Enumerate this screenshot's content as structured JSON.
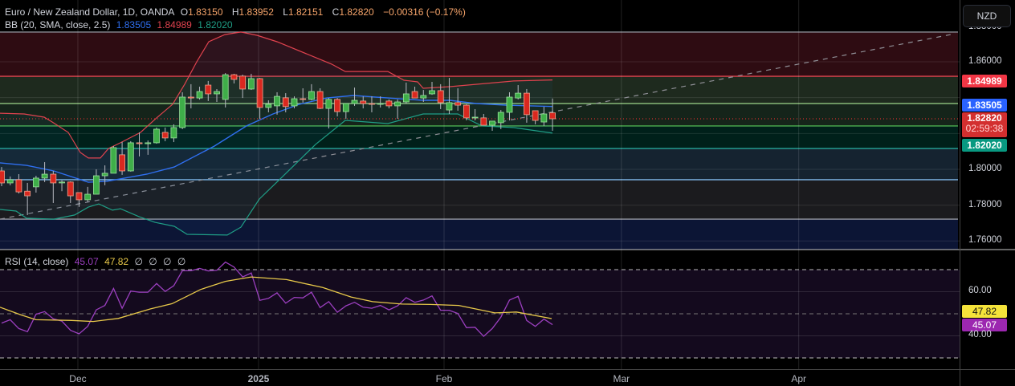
{
  "header": {
    "symbol_title": "Euro / New Zealand Dollar, 1D, OANDA",
    "open_label": "O",
    "open": "1.83150",
    "high_label": "H",
    "high": "1.83952",
    "low_label": "L",
    "low": "1.82151",
    "close_label": "C",
    "close": "1.82820",
    "change": "−0.00316 (−0.17%)"
  },
  "bb_legend": {
    "label": "BB (20, SMA, close, 2.5)",
    "basis": "1.83505",
    "upper": "1.84989",
    "lower": "1.82020"
  },
  "rsi_legend": {
    "label": "RSI (14, close)",
    "rsi": "45.07",
    "ma": "47.82",
    "extras": [
      "∅",
      "∅",
      "∅",
      "∅"
    ]
  },
  "currency_button": "NZD",
  "price_axis": {
    "ticks": [
      "1.88000",
      "1.86000",
      "1.80000",
      "1.78000",
      "1.76000"
    ],
    "badges": {
      "upper": "1.84989",
      "basis": "1.83505",
      "last": "1.82820",
      "countdown": "02:59:38",
      "lower": "1.82020"
    }
  },
  "rsi_axis": {
    "ticks": [
      "60.00",
      "40.00"
    ],
    "ma_badge": "47.82",
    "rsi_badge": "45.07"
  },
  "time_axis": [
    "Dec",
    "2025",
    "Feb",
    "Mar",
    "Apr"
  ],
  "colors": {
    "up": "#3fae49",
    "down": "#d9281f",
    "bb_upper": "#e0434f",
    "bb_basis": "#2f6ff0",
    "bb_lower": "#1f9e86",
    "rsi": "#9b3fbf",
    "rsi_ma": "#e8c94a",
    "last": "#d32f2f"
  },
  "chart_data": [
    {
      "type": "candlestick",
      "title": "Euro / New Zealand Dollar, 1D, OANDA",
      "ylim": [
        1.755,
        1.8785
      ],
      "yticks": [
        1.88,
        1.86,
        1.84,
        1.82,
        1.8,
        1.78,
        1.76
      ],
      "x_ticks": [
        {
          "label": "Dec",
          "bar": 8.86
        },
        {
          "label": "2025",
          "bar": 29.85
        },
        {
          "label": "Feb",
          "bar": 51.4
        },
        {
          "label": "Mar",
          "bar": 72.0
        },
        {
          "label": "Apr",
          "bar": 92.6
        }
      ],
      "ohlc": [
        [
          1.7991,
          1.8013,
          1.7906,
          1.7924
        ],
        [
          1.7924,
          1.796,
          1.7911,
          1.7942
        ],
        [
          1.7942,
          1.7973,
          1.7865,
          1.7874
        ],
        [
          1.7878,
          1.7924,
          1.7745,
          1.7852
        ],
        [
          1.7902,
          1.7964,
          1.787,
          1.7951
        ],
        [
          1.7951,
          1.804,
          1.7929,
          1.7973
        ],
        [
          1.7973,
          1.7991,
          1.7812,
          1.7924
        ],
        [
          1.7924,
          1.7938,
          1.7878,
          1.7929
        ],
        [
          1.7929,
          1.7933,
          1.7812,
          1.7852
        ],
        [
          1.787,
          1.787,
          1.779,
          1.783
        ],
        [
          1.783,
          1.7902,
          1.7817,
          1.7861
        ],
        [
          1.7861,
          1.8,
          1.7861,
          1.7964
        ],
        [
          1.7964,
          1.8022,
          1.7911,
          1.7978
        ],
        [
          1.7978,
          1.813,
          1.7978,
          1.8121
        ],
        [
          1.8081,
          1.8153,
          1.7969,
          1.7991
        ],
        [
          1.7991,
          1.8157,
          1.7987,
          1.8148
        ],
        [
          1.8148,
          1.8206,
          1.8072,
          1.8143
        ],
        [
          1.8143,
          1.8161,
          1.8081,
          1.8148
        ],
        [
          1.8148,
          1.8233,
          1.8143,
          1.8224
        ],
        [
          1.8206,
          1.8233,
          1.8157,
          1.8175
        ],
        [
          1.8175,
          1.8251,
          1.8152,
          1.8233
        ],
        [
          1.8233,
          1.843,
          1.8224,
          1.8403
        ],
        [
          1.8403,
          1.8475,
          1.834,
          1.8398
        ],
        [
          1.8398,
          1.8461,
          1.8389,
          1.8434
        ],
        [
          1.847,
          1.8493,
          1.8381,
          1.8421
        ],
        [
          1.8421,
          1.8448,
          1.8376,
          1.8434
        ],
        [
          1.839,
          1.8537,
          1.8345,
          1.8528
        ],
        [
          1.8528,
          1.8533,
          1.8479,
          1.8502
        ],
        [
          1.852,
          1.8528,
          1.8398,
          1.8448
        ],
        [
          1.8448,
          1.8533,
          1.8443,
          1.8506
        ],
        [
          1.8506,
          1.851,
          1.8282,
          1.8345
        ],
        [
          1.8345,
          1.8385,
          1.8318,
          1.8363
        ],
        [
          1.8354,
          1.843,
          1.8305,
          1.8407
        ],
        [
          1.8399,
          1.8425,
          1.8318,
          1.835
        ],
        [
          1.8354,
          1.8407,
          1.834,
          1.8394
        ],
        [
          1.8394,
          1.8452,
          1.8372,
          1.839
        ],
        [
          1.839,
          1.8475,
          1.8385,
          1.8434
        ],
        [
          1.8434,
          1.8452,
          1.8336,
          1.834
        ],
        [
          1.834,
          1.8398,
          1.8228,
          1.839
        ],
        [
          1.839,
          1.8398,
          1.8295,
          1.8322
        ],
        [
          1.8322,
          1.8367,
          1.8282,
          1.8367
        ],
        [
          1.8367,
          1.8456,
          1.8354,
          1.8385
        ],
        [
          1.8381,
          1.8407,
          1.834,
          1.8367
        ],
        [
          1.8367,
          1.8407,
          1.8318,
          1.8363
        ],
        [
          1.8363,
          1.8407,
          1.8345,
          1.8367
        ],
        [
          1.8381,
          1.839,
          1.834,
          1.8354
        ],
        [
          1.8354,
          1.839,
          1.8282,
          1.8376
        ],
        [
          1.8376,
          1.8484,
          1.8367,
          1.8421
        ],
        [
          1.8434,
          1.8461,
          1.8398,
          1.8398
        ],
        [
          1.8398,
          1.8443,
          1.8376,
          1.8412
        ],
        [
          1.8421,
          1.8488,
          1.8416,
          1.8439
        ],
        [
          1.8439,
          1.8475,
          1.8336,
          1.8372
        ],
        [
          1.8331,
          1.851,
          1.8309,
          1.8372
        ],
        [
          1.8372,
          1.8452,
          1.8327,
          1.8358
        ],
        [
          1.8358,
          1.8363,
          1.8273,
          1.8287
        ],
        [
          1.8291,
          1.8336,
          1.8273,
          1.8291
        ],
        [
          1.8287,
          1.8309,
          1.8246,
          1.8246
        ],
        [
          1.8246,
          1.8269,
          1.8215,
          1.8269
        ],
        [
          1.826,
          1.8331,
          1.8224,
          1.8318
        ],
        [
          1.8318,
          1.843,
          1.8273,
          1.8403
        ],
        [
          1.8398,
          1.847,
          1.839,
          1.8425
        ],
        [
          1.8425,
          1.8448,
          1.826,
          1.8305
        ],
        [
          1.8327,
          1.8327,
          1.8251,
          1.8273
        ],
        [
          1.8264,
          1.8349,
          1.8242,
          1.8309
        ],
        [
          1.8315,
          1.83952,
          1.82151,
          1.8282
        ]
      ],
      "bb_upper": [
        [
          -0.19,
          1.8313
        ],
        [
          2.61,
          1.8309
        ],
        [
          4.94,
          1.8291
        ],
        [
          5.88,
          1.8264
        ],
        [
          7.74,
          1.8206
        ],
        [
          9.14,
          1.8094
        ],
        [
          10.07,
          1.8063
        ],
        [
          11.47,
          1.8063
        ],
        [
          12.41,
          1.8116
        ],
        [
          13.81,
          1.8148
        ],
        [
          16.14,
          1.8206
        ],
        [
          18.0,
          1.8287
        ],
        [
          19.87,
          1.8363
        ],
        [
          21.27,
          1.8475
        ],
        [
          22.67,
          1.86
        ],
        [
          24.07,
          1.8712
        ],
        [
          25.93,
          1.8752
        ],
        [
          27.8,
          1.8766
        ],
        [
          29.66,
          1.8748
        ],
        [
          32.0,
          1.8712
        ],
        [
          38.34,
          1.8587
        ],
        [
          39.93,
          1.8546
        ],
        [
          44.87,
          1.8546
        ],
        [
          46.74,
          1.8497
        ],
        [
          48.32,
          1.8488
        ],
        [
          48.97,
          1.8452
        ],
        [
          52.05,
          1.8461
        ],
        [
          59.5,
          1.8493
        ],
        [
          63.99,
          1.84989
        ]
      ],
      "bb_basis": [
        [
          -0.19,
          1.8036
        ],
        [
          2.89,
          1.8022
        ],
        [
          6.06,
          1.7991
        ],
        [
          10.07,
          1.7928
        ],
        [
          12.22,
          1.7933
        ],
        [
          16.88,
          1.7973
        ],
        [
          20.06,
          1.8013
        ],
        [
          24.72,
          1.813
        ],
        [
          28.45,
          1.8242
        ],
        [
          31.53,
          1.8309
        ],
        [
          34.6,
          1.8363
        ],
        [
          37.78,
          1.8398
        ],
        [
          40.86,
          1.8412
        ],
        [
          44.87,
          1.8398
        ],
        [
          48.97,
          1.8385
        ],
        [
          52.05,
          1.8385
        ],
        [
          55.13,
          1.8367
        ],
        [
          58.58,
          1.8358
        ],
        [
          63.99,
          1.83505
        ]
      ],
      "bb_lower": [
        [
          -0.19,
          1.7776
        ],
        [
          1.68,
          1.7767
        ],
        [
          2.89,
          1.7727
        ],
        [
          6.06,
          1.7722
        ],
        [
          8.49,
          1.7745
        ],
        [
          10.07,
          1.7789
        ],
        [
          11.29,
          1.7807
        ],
        [
          12.87,
          1.7772
        ],
        [
          13.81,
          1.778
        ],
        [
          15.95,
          1.7736
        ],
        [
          17.82,
          1.7704
        ],
        [
          20.06,
          1.7682
        ],
        [
          21.55,
          1.7637
        ],
        [
          26.21,
          1.7633
        ],
        [
          27.8,
          1.7677
        ],
        [
          29.94,
          1.7834
        ],
        [
          32.46,
          1.7951
        ],
        [
          36.47,
          1.8139
        ],
        [
          39.93,
          1.8273
        ],
        [
          44.87,
          1.8255
        ],
        [
          48.97,
          1.8309
        ],
        [
          52.99,
          1.8309
        ],
        [
          55.78,
          1.8242
        ],
        [
          59.51,
          1.8233
        ],
        [
          63.99,
          1.8202
        ]
      ],
      "levels": [
        {
          "price": 1.8766,
          "color": "#8a8d96",
          "fill": "#2e0c12"
        },
        {
          "price": 1.8519,
          "color": "#e0434f",
          "fill": "#1e2a1e"
        },
        {
          "price": 1.8367,
          "color": "#9ed68a",
          "fill": "#15241a"
        },
        {
          "price": 1.8242,
          "color": "#4caf50",
          "fill": "#00201a"
        },
        {
          "price": 1.8116,
          "color": "#26a69a",
          "fill": "#152330"
        },
        {
          "price": 1.7942,
          "color": "#7fb8e8",
          "fill": "#1b1b1e"
        },
        {
          "price": 1.7722,
          "color": "#9598a1",
          "fill": "#0c1535"
        }
      ],
      "trendline": {
        "from": [
          -0.19,
          1.7722
        ],
        "to": [
          110.8,
          1.8757
        ]
      },
      "last_price": 1.8282
    },
    {
      "type": "line",
      "title": "RSI (14, close)",
      "ylim": [
        22.5,
        78.5
      ],
      "bands": [
        70,
        50,
        30
      ],
      "grid": [
        60,
        40
      ],
      "rsi": [
        45.8,
        47.3,
        43.3,
        41.9,
        49.8,
        51.0,
        47.7,
        46.7,
        42.5,
        40.9,
        44.3,
        51.8,
        53.8,
        61.5,
        52.5,
        60.3,
        59.8,
        59.8,
        63.7,
        60.1,
        62.7,
        69.5,
        69.5,
        70.6,
        69.4,
        69.7,
        73.4,
        71.2,
        66.7,
        68.5,
        56.1,
        57.0,
        59.5,
        54.8,
        57.4,
        57.2,
        59.8,
        52.8,
        55.5,
        50.7,
        53.6,
        55.2,
        53.0,
        52.5,
        53.8,
        51.8,
        53.6,
        57.3,
        55.2,
        56.2,
        58.1,
        51.6,
        51.6,
        50.1,
        43.7,
        43.9,
        39.8,
        43.3,
        48.5,
        56.2,
        57.9,
        47.0,
        44.3,
        47.6,
        45.07
      ],
      "rsi_ma": [
        [
          -0.19,
          53.0
        ],
        [
          2.31,
          49.4
        ],
        [
          3.98,
          47.3
        ],
        [
          8.14,
          47.0
        ],
        [
          10.64,
          46.5
        ],
        [
          13.55,
          47.9
        ],
        [
          17.3,
          52.2
        ],
        [
          19.8,
          54.6
        ],
        [
          23.1,
          61.0
        ],
        [
          26.0,
          64.7
        ],
        [
          29.0,
          66.7
        ],
        [
          33.1,
          65.5
        ],
        [
          37.3,
          61.9
        ],
        [
          40.6,
          57.6
        ],
        [
          43.1,
          55.5
        ],
        [
          46.5,
          54.4
        ],
        [
          49.8,
          54.2
        ],
        [
          53.1,
          53.8
        ],
        [
          57.3,
          50.4
        ],
        [
          59.8,
          50.8
        ],
        [
          63.9,
          47.82
        ]
      ]
    }
  ]
}
